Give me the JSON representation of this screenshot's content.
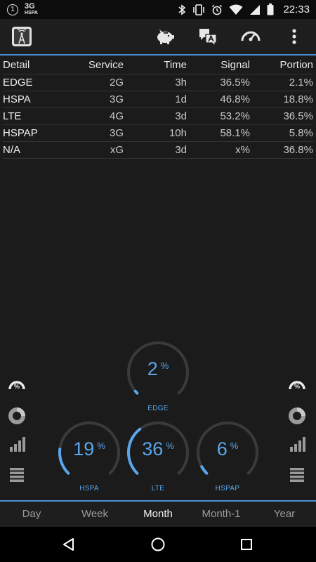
{
  "status_bar": {
    "notification_count": "1",
    "network_type": "3G",
    "network_subtype": "HSPA",
    "time": "22:33",
    "icons": [
      "bluetooth-icon",
      "vibrate-icon",
      "alarm-icon",
      "wifi-icon",
      "signal-icon",
      "battery-icon"
    ]
  },
  "toolbar": {
    "app_icon": "tower-icon",
    "actions": [
      "piggy-bank-icon",
      "translate-icon",
      "speedometer-icon",
      "overflow-menu-icon"
    ]
  },
  "table": {
    "headers": [
      "Detail",
      "Service",
      "Time",
      "Signal",
      "Portion"
    ],
    "rows": [
      [
        "EDGE",
        "2G",
        "3h",
        "36.5%",
        "2.1%"
      ],
      [
        "HSPA",
        "3G",
        "1d",
        "46.8%",
        "18.8%"
      ],
      [
        "LTE",
        "4G",
        "3d",
        "53.2%",
        "36.5%"
      ],
      [
        "HSPAP",
        "3G",
        "10h",
        "58.1%",
        "5.8%"
      ],
      [
        "N/A",
        "xG",
        "3d",
        "x%",
        "36.8%"
      ]
    ]
  },
  "gauges": [
    {
      "label": "EDGE",
      "value": "2",
      "unit": "%",
      "fraction": 0.02
    },
    {
      "label": "HSPA",
      "value": "19",
      "unit": "%",
      "fraction": 0.19
    },
    {
      "label": "LTE",
      "value": "36",
      "unit": "%",
      "fraction": 0.36
    },
    {
      "label": "HSPAP",
      "value": "6",
      "unit": "%",
      "fraction": 0.06
    }
  ],
  "side_icons": {
    "gauge_badge": "%",
    "items": [
      "percent-gauge-icon",
      "donut-chart-icon",
      "bar-chart-icon",
      "list-icon"
    ]
  },
  "tabs": {
    "items": [
      "Day",
      "Week",
      "Month",
      "Month-1",
      "Year"
    ],
    "active": "Month"
  },
  "colors": {
    "accent": "#4a90d9",
    "gauge_value": "#5aa6ea",
    "gauge_track": "#3a3a3a"
  }
}
